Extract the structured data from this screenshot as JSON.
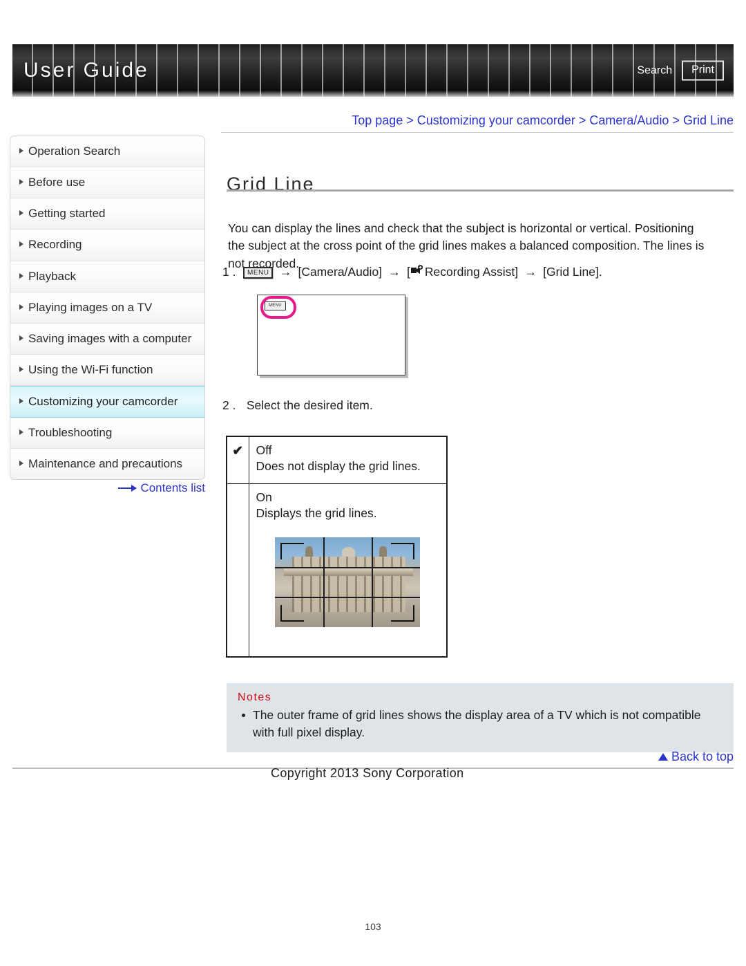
{
  "header": {
    "title": "User Guide",
    "search_label": "Search",
    "print_label": "Print"
  },
  "sidebar": {
    "items": [
      {
        "label": "Operation Search",
        "active": false
      },
      {
        "label": "Before use",
        "active": false
      },
      {
        "label": "Getting started",
        "active": false
      },
      {
        "label": "Recording",
        "active": false
      },
      {
        "label": "Playback",
        "active": false
      },
      {
        "label": "Playing images on a TV",
        "active": false
      },
      {
        "label": "Saving images with a computer",
        "active": false
      },
      {
        "label": "Using the Wi-Fi function",
        "active": false
      },
      {
        "label": "Customizing your camcorder",
        "active": true
      },
      {
        "label": "Troubleshooting",
        "active": false
      },
      {
        "label": "Maintenance and precautions",
        "active": false
      }
    ],
    "contents_list_label": "Contents list"
  },
  "main": {
    "breadcrumb": "Top page > Customizing your camcorder > Camera/Audio > Grid Line",
    "title": "Grid Line",
    "intro": "You can display the lines and check that the subject is horizontal or vertical. Positioning the subject at the cross point of the grid lines makes a balanced composition. The lines is not recorded.",
    "step1": {
      "number": "1 .",
      "menu_chip": "MENU",
      "arrow": "→",
      "part_camera_audio": "[Camera/Audio]",
      "part_recording_assist": "Recording Assist]",
      "bracket_open": "[",
      "part_grid_line": "[Grid Line]."
    },
    "screen_illustration": {
      "menu_chip": "MENU"
    },
    "step2": {
      "number": "2 .",
      "text": "Select the desired item."
    },
    "options_table": {
      "rows": [
        {
          "checked": "✔",
          "name": "Off",
          "description": "Does not display the grid lines."
        },
        {
          "checked": "",
          "name": "On",
          "description": "Displays the grid lines."
        }
      ]
    },
    "notes": {
      "heading": "Notes",
      "items": [
        "The outer frame of grid lines shows the display area of a TV which is not compatible with full pixel display."
      ]
    },
    "back_to_top_label": "Back to top"
  },
  "footer": {
    "copyright": "Copyright 2013 Sony Corporation",
    "page_number": "103"
  },
  "colors": {
    "link_blue": "#2b34c8",
    "notes_red": "#cf0a13",
    "notes_bg": "#dfe4e8",
    "active_nav": "#d9f4fb",
    "highlight_magenta": "#e6198c"
  }
}
